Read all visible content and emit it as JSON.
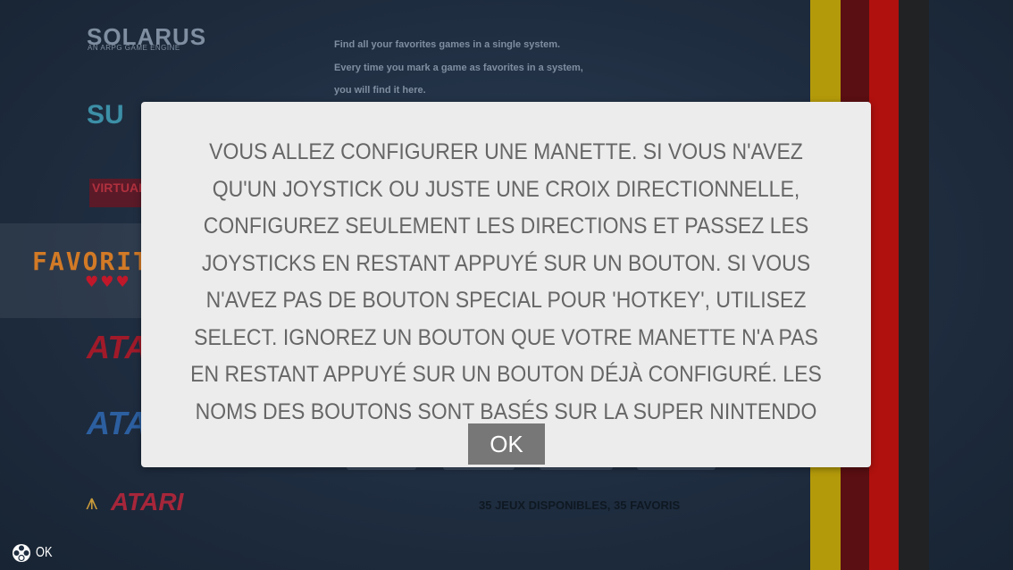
{
  "systems": {
    "solarus_logo": "SOLARUS",
    "solarus_subtitle": "AN ARPG GAME ENGINE",
    "sliver_logo": "SU",
    "virtual_logo": "VIRTUAL BOY",
    "favorites_logo": "FAVORITES",
    "hearts": "♥♥♥",
    "atari_1": "ATARI",
    "atari_2": "ATARI",
    "atari_3": "ATARI"
  },
  "description": {
    "line1": "Find all your favorites games in a single system.",
    "line2": "Every time you mark a game as favorites in a system,",
    "line3": "you will find it here."
  },
  "game_count": "35 JEUX DISPONIBLES, 35 FAVORIS",
  "dialog": {
    "message": "VOUS ALLEZ CONFIGURER UNE MANETTE. SI VOUS N'AVEZ QU'UN JOYSTICK OU JUSTE UNE CROIX DIRECTIONNELLE, CONFIGUREZ SEULEMENT LES DIRECTIONS ET PASSEZ LES JOYSTICKS EN RESTANT APPUYÉ SUR UN BOUTON. SI VOUS N'AVEZ PAS DE BOUTON SPECIAL POUR 'HOTKEY', UTILISEZ SELECT. IGNOREZ UN BOUTON QUE VOTRE MANETTE N'A PAS EN RESTANT APPUYÉ SUR UN BOUTON DÉJÀ CONFIGURÉ. LES NOMS DES BOUTONS SONT BASÉS SUR LA SUPER NINTENDO",
    "ok_label": "OK"
  },
  "help_bar": {
    "icon": "gamepad-buttons-icon",
    "ok_label": "OK"
  },
  "colors": {
    "stripe_yellow": "#b39a0a",
    "stripe_darkred": "#5a0f12",
    "stripe_red": "#b0110e",
    "stripe_dark": "#202224",
    "dialog_bg": "#ececec",
    "dialog_text": "#666666",
    "ok_button": "#777777"
  }
}
